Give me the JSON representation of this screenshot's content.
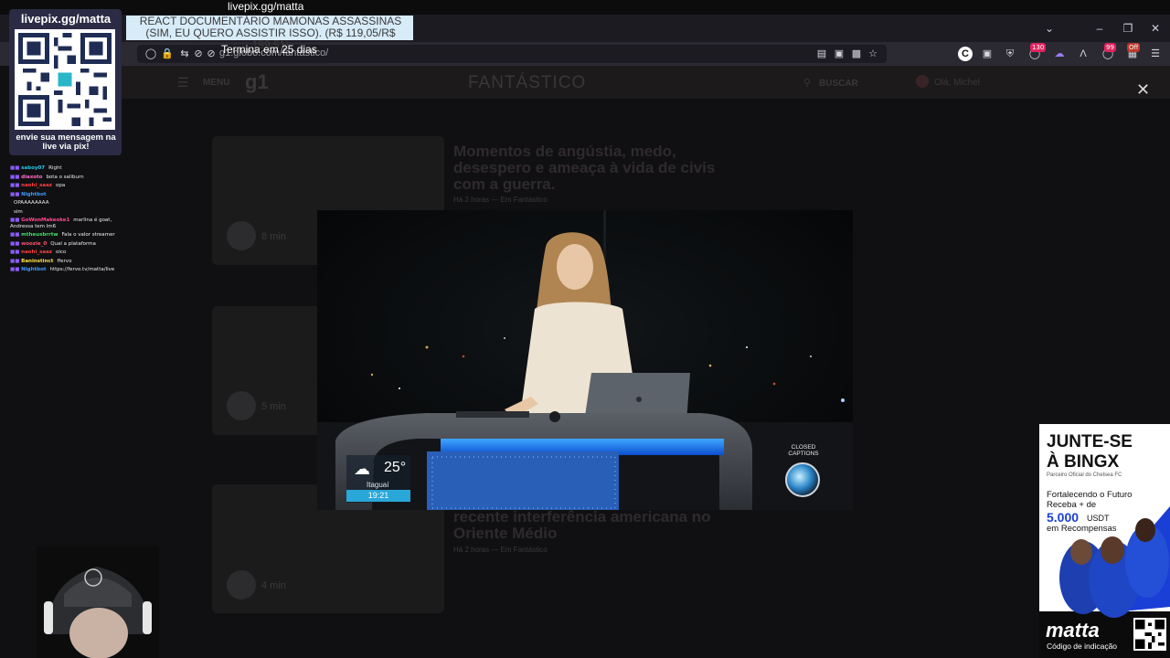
{
  "overlay": {
    "stream_title": "livepix.gg/matta",
    "qr_title": "livepix.gg/matta",
    "qr_caption": "envie sua mensagem na live via pix!",
    "donation_text": "REACT DOCUMENTÁRIO MAMONAS ASSASSINAS (SIM, EU QUERO ASSISTIR ISSO). (R$ 119,05/R$ 199,51)",
    "subscription_note": "Termina em 25 dias"
  },
  "browser": {
    "url": "g1.globo.com/fantastico/",
    "badges": [
      "130",
      "99",
      "Off"
    ],
    "extension_letter": "C"
  },
  "g1": {
    "menu_label": "MENU",
    "logo": "g1",
    "section_title": "FANTÁSTICO",
    "search_label": "BUSCAR",
    "user_label": "Olá, Michel"
  },
  "articles": [
    {
      "headline": "Momentos de angústia, medo, desespero e ameaça à vida de civis com a guerra.",
      "meta": "Há 2 horas — Em Fantástico",
      "duration": "8 min"
    },
    {
      "headline": "",
      "meta": "",
      "duration": "5 min"
    },
    {
      "headline": "recente interferência americana no Oriente Médio",
      "meta": "Há 2 horas — Em Fantástico",
      "duration": "4 min"
    }
  ],
  "video": {
    "temperature": "25°",
    "city": "Itaguaí",
    "clock": "19:21",
    "closed_captions": "CLOSED CAPTIONS"
  },
  "chat": [
    {
      "user": "saboy07",
      "color": "#28c8e6",
      "msg": "Right"
    },
    {
      "user": "diaxoto",
      "color": "#ff6ec7",
      "msg": "bota o saliburn"
    },
    {
      "user": "naohi_saaz",
      "color": "#ff4040",
      "msg": "opa"
    },
    {
      "user": "Nightbot",
      "color": "#3a9bff",
      "msg": ""
    },
    {
      "user": "",
      "color": "#eeeeee",
      "msg": "OPAAAAAAAA"
    },
    {
      "user": "",
      "color": "#eeeeee",
      "msg": "sim"
    },
    {
      "user": "GoWonMakeoke1",
      "color": "#ff4a8f",
      "msg": "marlina é goat, Andressa tem lm6"
    },
    {
      "user": "mtheusbrrtw",
      "color": "#44dd66",
      "msg": "Fala o valor streamer"
    },
    {
      "user": "woozie_0",
      "color": "#ff5070",
      "msg": "Qual a plataforma"
    },
    {
      "user": "naohi_saaz",
      "color": "#ff4040",
      "msg": "oico"
    },
    {
      "user": "Baninstinct",
      "color": "#ffe04a",
      "msg": "ffervo"
    },
    {
      "user": "Nightbot",
      "color": "#3a9bff",
      "msg": "https://fervo.tv/matta/live"
    }
  ],
  "ad": {
    "headline_1": "JUNTE-SE",
    "headline_2": "À BINGX",
    "partner": "Parceiro Oficial do Chelsea FC",
    "line1": "Fortalecendo o Futuro",
    "line2": "Receba + de",
    "amount": "5.000",
    "currency": "USDT",
    "line3": "em Recompensas",
    "brand": "matta",
    "code_label": "Código de indicação"
  },
  "colors": {
    "ad_blue": "#1a3fd6",
    "cc_teal": "#2aa7d9"
  }
}
